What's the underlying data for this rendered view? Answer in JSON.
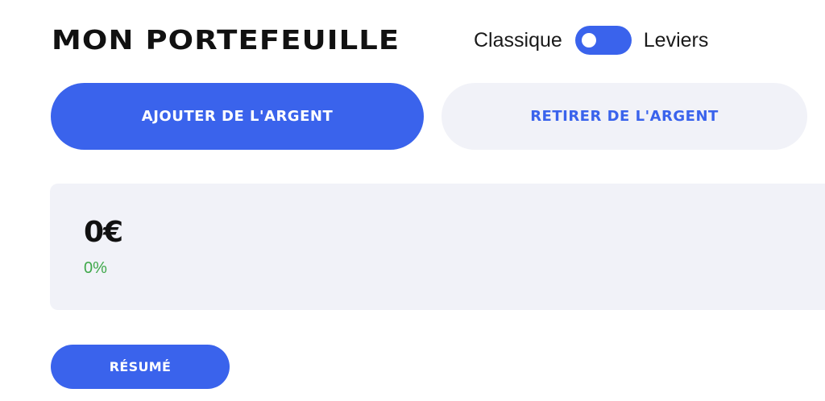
{
  "header": {
    "title": "MON PORTEFEUILLE",
    "mode_left_label": "Classique",
    "mode_right_label": "Leviers",
    "toggle_state": "Classique"
  },
  "actions": {
    "add_money_label": "AJOUTER DE L'ARGENT",
    "withdraw_money_label": "RETIRER DE L'ARGENT"
  },
  "balance": {
    "amount": "0€",
    "change": "0%"
  },
  "summary_button_label": "RÉSUMÉ",
  "colors": {
    "accent": "#3a63ec",
    "card_background": "#f1f2f8",
    "positive": "#3fa84a"
  }
}
